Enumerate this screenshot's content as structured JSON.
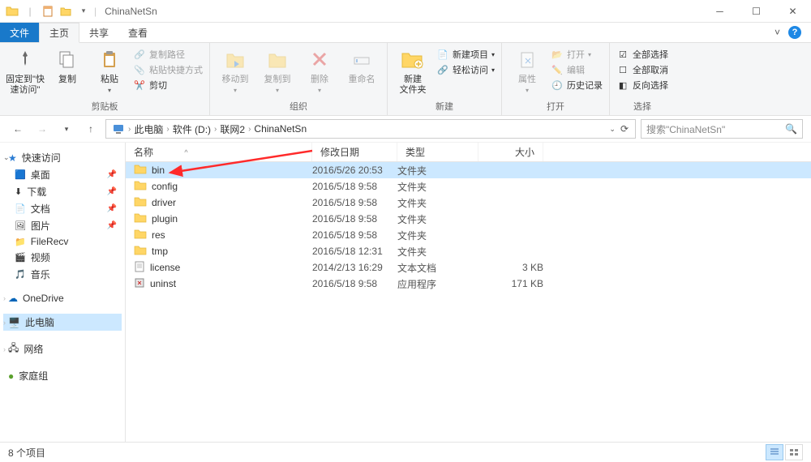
{
  "window": {
    "title": "ChinaNetSn"
  },
  "ribbon": {
    "tabs": {
      "file": "文件",
      "home": "主页",
      "share": "共享",
      "view": "查看"
    },
    "groups": {
      "clipboard": {
        "label": "剪贴板",
        "pin": "固定到\"快\n速访问\"",
        "copy": "复制",
        "paste": "粘贴",
        "copy_path": "复制路径",
        "paste_shortcut": "粘贴快捷方式",
        "cut": "剪切"
      },
      "organize": {
        "label": "组织",
        "move": "移动到",
        "copy_to": "复制到",
        "delete": "删除",
        "rename": "重命名"
      },
      "new": {
        "label": "新建",
        "new_folder": "新建\n文件夹",
        "new_item": "新建项目",
        "easy_access": "轻松访问"
      },
      "open": {
        "label": "打开",
        "properties": "属性",
        "open": "打开",
        "edit": "编辑",
        "history": "历史记录"
      },
      "select": {
        "label": "选择",
        "select_all": "全部选择",
        "select_none": "全部取消",
        "invert": "反向选择"
      }
    }
  },
  "breadcrumb": {
    "items": [
      "此电脑",
      "软件 (D:)",
      "联网2",
      "ChinaNetSn"
    ],
    "search_placeholder": "搜索\"ChinaNetSn\""
  },
  "navpane": {
    "quick": {
      "header": "快速访问",
      "items": [
        {
          "label": "桌面",
          "pinned": true
        },
        {
          "label": "下载",
          "pinned": true
        },
        {
          "label": "文档",
          "pinned": true
        },
        {
          "label": "图片",
          "pinned": true
        },
        {
          "label": "FileRecv",
          "pinned": false
        },
        {
          "label": "视频",
          "pinned": false
        },
        {
          "label": "音乐",
          "pinned": false
        }
      ]
    },
    "onedrive": "OneDrive",
    "this_pc": "此电脑",
    "network": "网络",
    "homegroup": "家庭组"
  },
  "columns": {
    "name": "名称",
    "date": "修改日期",
    "type": "类型",
    "size": "大小"
  },
  "files": [
    {
      "name": "bin",
      "date": "2016/5/26 20:53",
      "type": "文件夹",
      "size": "",
      "icon": "folder",
      "selected": true
    },
    {
      "name": "config",
      "date": "2016/5/18 9:58",
      "type": "文件夹",
      "size": "",
      "icon": "folder"
    },
    {
      "name": "driver",
      "date": "2016/5/18 9:58",
      "type": "文件夹",
      "size": "",
      "icon": "folder"
    },
    {
      "name": "plugin",
      "date": "2016/5/18 9:58",
      "type": "文件夹",
      "size": "",
      "icon": "folder"
    },
    {
      "name": "res",
      "date": "2016/5/18 9:58",
      "type": "文件夹",
      "size": "",
      "icon": "folder"
    },
    {
      "name": "tmp",
      "date": "2016/5/18 12:31",
      "type": "文件夹",
      "size": "",
      "icon": "folder"
    },
    {
      "name": "license",
      "date": "2014/2/13 16:29",
      "type": "文本文档",
      "size": "3 KB",
      "icon": "text"
    },
    {
      "name": "uninst",
      "date": "2016/5/18 9:58",
      "type": "应用程序",
      "size": "171 KB",
      "icon": "exe"
    }
  ],
  "status": {
    "count": "8 个项目"
  }
}
